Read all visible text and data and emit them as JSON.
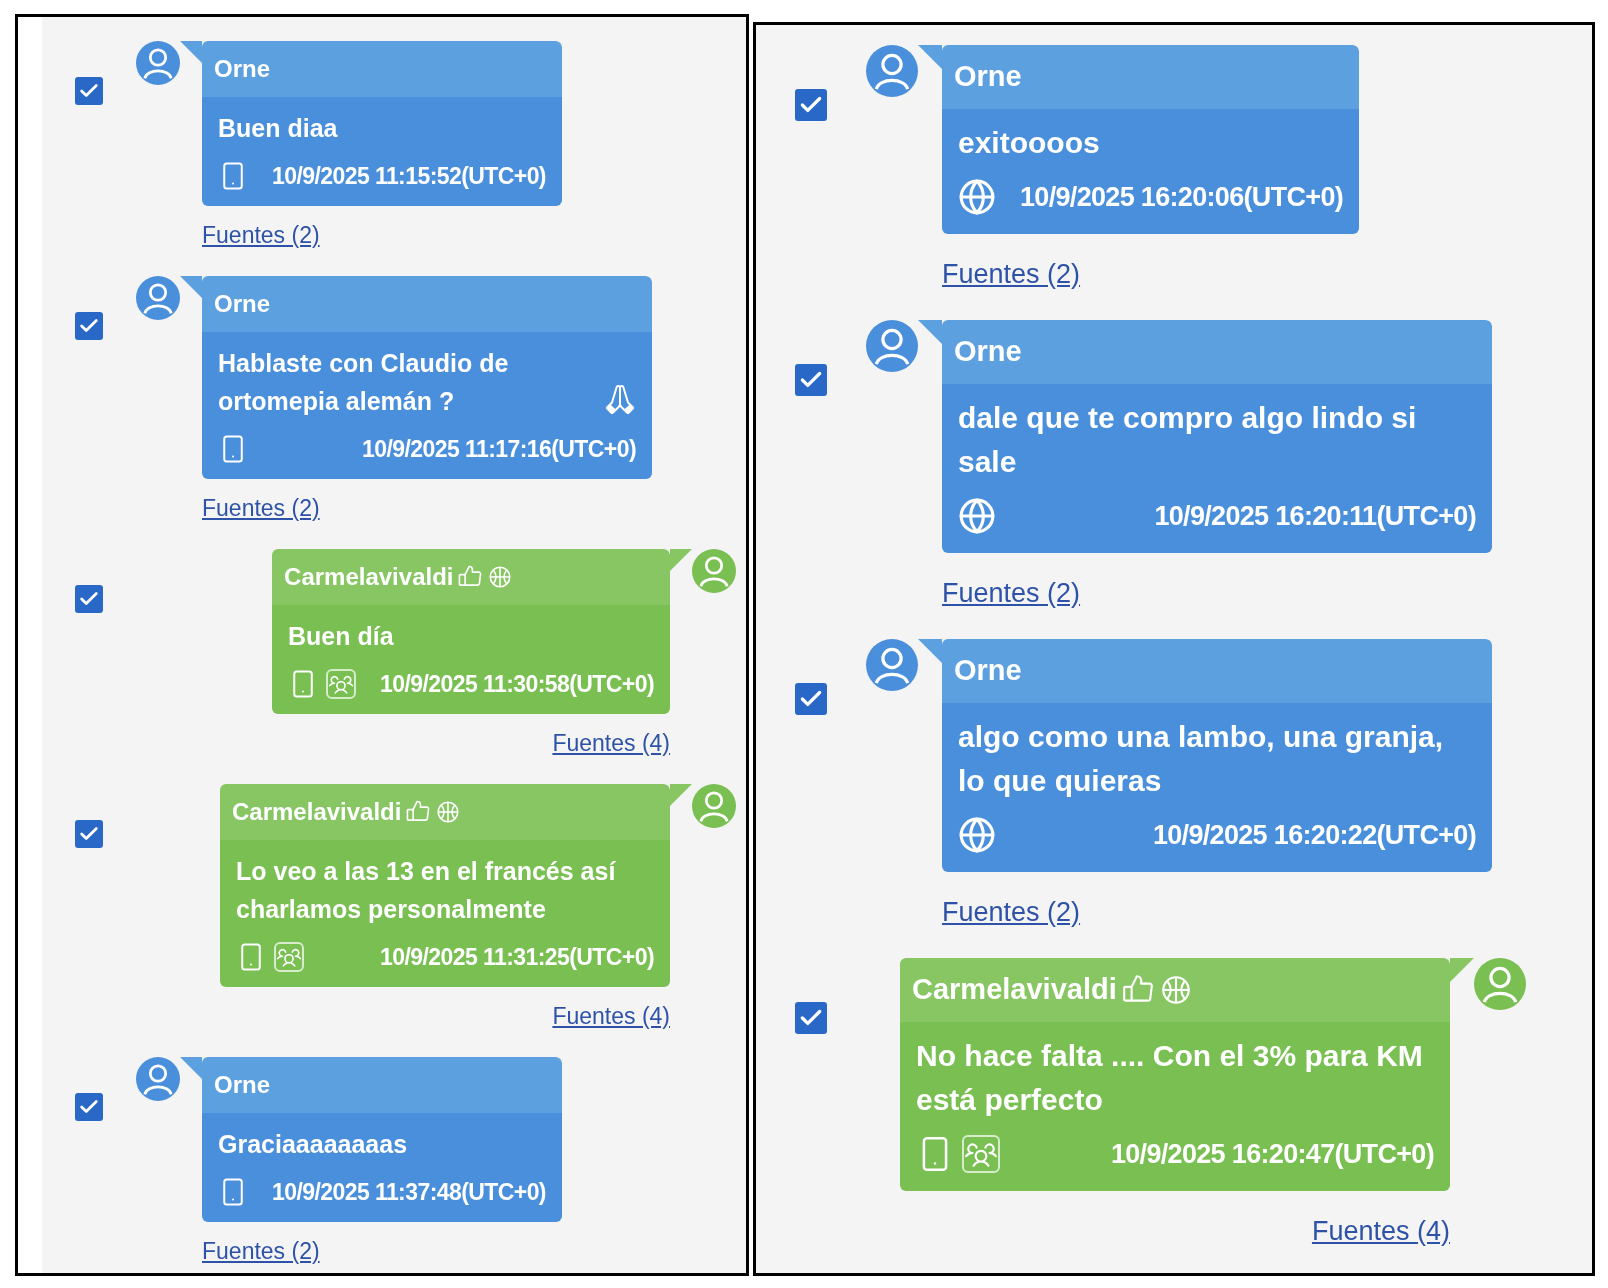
{
  "panels": [
    {
      "messages": [
        {
          "kind": "blue",
          "checked": true,
          "sender": "Orne",
          "text": "Buen diaa",
          "emoji": false,
          "status_icons": [
            {
              "kind": "phone"
            }
          ],
          "date": "10/9/2025 11:15:52(UTC+0)",
          "sources": "Fuentes (2)"
        },
        {
          "kind": "blue",
          "checked": true,
          "sender": "Orne",
          "text": "Hablaste con Claudio de ortomepia alemán ?",
          "emoji": true,
          "status_icons": [
            {
              "kind": "phone"
            }
          ],
          "date": "10/9/2025 11:17:16(UTC+0)",
          "sources": "Fuentes (2)"
        },
        {
          "kind": "green",
          "checked": true,
          "sender": "Carmelavivaldi",
          "text": "Buen día",
          "emoji": false,
          "status_icons": [
            {
              "kind": "phone"
            },
            {
              "kind": "group"
            }
          ],
          "date": "10/9/2025 11:30:58(UTC+0)",
          "sources": "Fuentes (4)"
        },
        {
          "kind": "green",
          "checked": true,
          "sender": "Carmelavivaldi",
          "text": "Lo veo a las 13 en el francés así charlamos personalmente",
          "emoji": false,
          "status_icons": [
            {
              "kind": "phone"
            },
            {
              "kind": "group"
            }
          ],
          "date": "10/9/2025 11:31:25(UTC+0)",
          "sources": "Fuentes (4)"
        },
        {
          "kind": "blue",
          "checked": true,
          "sender": "Orne",
          "text": "Graciaaaaaaaas",
          "emoji": false,
          "status_icons": [
            {
              "kind": "phone"
            }
          ],
          "date": "10/9/2025 11:37:48(UTC+0)",
          "sources": "Fuentes (2)"
        }
      ]
    },
    {
      "messages": [
        {
          "kind": "blue",
          "checked": true,
          "sender": "Orne",
          "text": "exitoooos",
          "emoji": false,
          "status_icons": [
            {
              "kind": "web"
            }
          ],
          "date": "10/9/2025 16:20:06(UTC+0)",
          "sources": "Fuentes (2)"
        },
        {
          "kind": "blue",
          "checked": true,
          "sender": "Orne",
          "text": "dale que te compro algo lindo si sale",
          "emoji": false,
          "status_icons": [
            {
              "kind": "web"
            }
          ],
          "date": "10/9/2025 16:20:11(UTC+0)",
          "sources": "Fuentes (2)"
        },
        {
          "kind": "blue",
          "checked": true,
          "sender": "Orne",
          "text": "algo como una lambo, una granja, lo que quieras",
          "emoji": false,
          "status_icons": [
            {
              "kind": "web"
            }
          ],
          "date": "10/9/2025 16:20:22(UTC+0)",
          "sources": "Fuentes (2)"
        },
        {
          "kind": "green",
          "checked": true,
          "sender": "Carmelavivaldi",
          "text": "No hace falta .... Con el 3% para KM está perfecto",
          "emoji": false,
          "status_icons": [
            {
              "kind": "phone"
            },
            {
              "kind": "group"
            }
          ],
          "date": "10/9/2025 16:20:47(UTC+0)",
          "sources": "Fuentes (4)"
        }
      ]
    }
  ]
}
